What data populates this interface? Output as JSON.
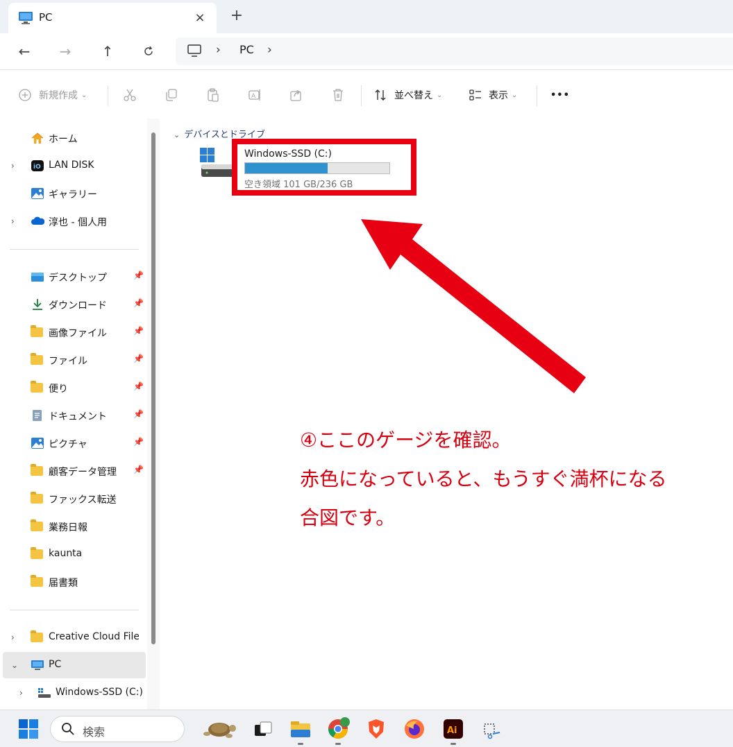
{
  "window": {
    "tab_title": "PC",
    "tab_close": "×",
    "new_tab": "+"
  },
  "nav": {
    "back": "←",
    "forward": "→",
    "up": "↑",
    "refresh": "C",
    "breadcrumb_sep": "›",
    "breadcrumb": "PC"
  },
  "toolbar": {
    "new_label": "新規作成",
    "sort_label": "並べ替え",
    "view_label": "表示",
    "more_label": "•••"
  },
  "sidebar": {
    "items": [
      {
        "label": "ホーム",
        "icon": "home-icon"
      },
      {
        "label": "LAN DISK",
        "icon": "lan-disk-icon"
      },
      {
        "label": "ギャラリー",
        "icon": "gallery-icon"
      },
      {
        "label": "淳也 - 個人用",
        "icon": "onedrive-icon"
      }
    ],
    "pinned": [
      {
        "label": "デスクトップ",
        "icon": "desktop-icon"
      },
      {
        "label": "ダウンロード",
        "icon": "download-icon"
      },
      {
        "label": "画像ファイル",
        "icon": "folder-icon"
      },
      {
        "label": "ファイル",
        "icon": "folder-icon"
      },
      {
        "label": "便り",
        "icon": "folder-icon"
      },
      {
        "label": "ドキュメント",
        "icon": "documents-icon"
      },
      {
        "label": "ピクチャ",
        "icon": "pictures-icon"
      },
      {
        "label": "顧客データ管理",
        "icon": "folder-icon"
      },
      {
        "label": "ファックス転送",
        "icon": "folder-icon"
      },
      {
        "label": "業務日報",
        "icon": "folder-icon"
      },
      {
        "label": "kaunta",
        "icon": "folder-icon"
      },
      {
        "label": "届書類",
        "icon": "folder-icon"
      }
    ],
    "bottom": [
      {
        "label": "Creative Cloud Files P",
        "icon": "folder-icon"
      },
      {
        "label": "PC",
        "icon": "pc-icon"
      },
      {
        "label": "Windows-SSD (C:)",
        "icon": "drive-icon"
      }
    ]
  },
  "content": {
    "group_header": "デバイスとドライブ",
    "drive": {
      "name": "Windows-SSD (C:)",
      "free_text": "空き領域 101 GB/236 GB",
      "used_fraction": 0.57,
      "bar_color": "#2e92cf"
    }
  },
  "annotation": {
    "line1": "④ここのゲージを確認。",
    "line2": "赤色になっていると、もうすぐ満杯になる",
    "line3": "合図です。",
    "color": "#d7000f"
  },
  "taskbar": {
    "search_placeholder": "検索"
  }
}
